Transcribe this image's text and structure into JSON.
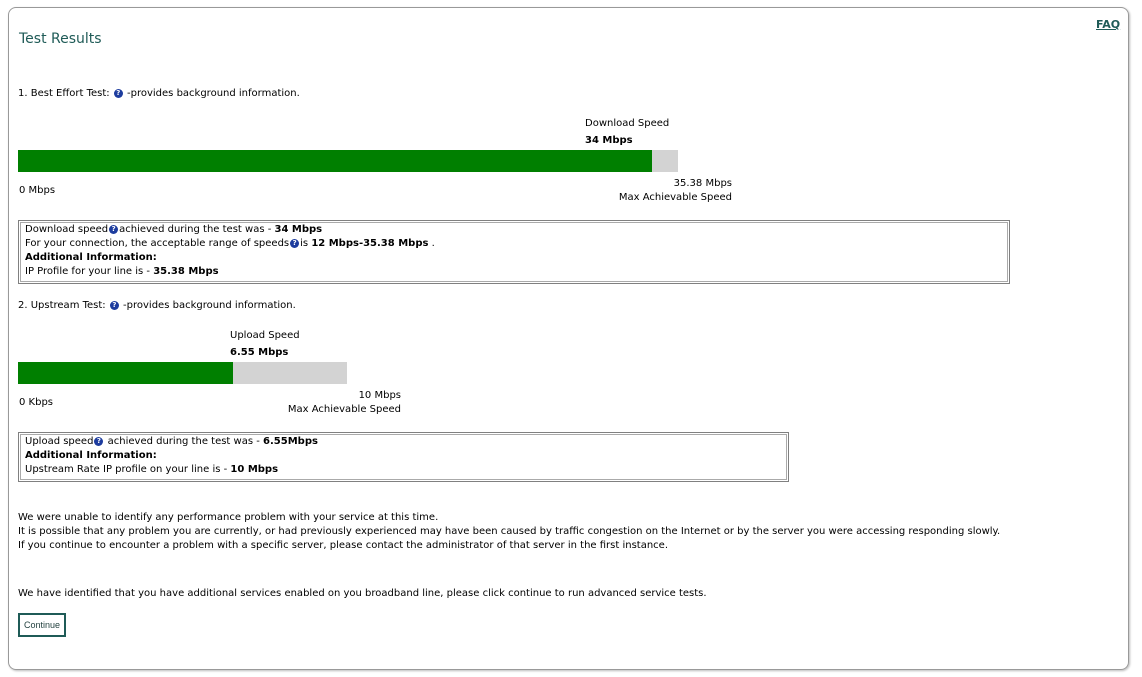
{
  "header": {
    "title": "Test Results",
    "faq_label": "FAQ"
  },
  "download": {
    "heading_prefix": "1. Best Effort Test:",
    "heading_suffix": "-provides background information.",
    "speed_label": "Download Speed",
    "speed_value": "34 Mbps",
    "min_label": "0 Mbps",
    "max_value": "35.38 Mbps",
    "max_label": "Max Achievable Speed",
    "fill_fraction": 0.961,
    "info": {
      "line1_prefix": "Download speed",
      "line1_mid": "achieved during the test was -",
      "line1_value": "34 Mbps",
      "line2_prefix": "For your connection, the acceptable range of speeds",
      "line2_mid": "is",
      "line2_value": "12 Mbps-35.38 Mbps",
      "line2_suffix": ".",
      "additional_label": "Additional Information:",
      "line4_prefix": "IP Profile for your line is -",
      "line4_value": "35.38 Mbps"
    }
  },
  "upload": {
    "heading_prefix": "2. Upstream Test:",
    "heading_suffix": "-provides background information.",
    "speed_label": "Upload Speed",
    "speed_value": "6.55 Mbps",
    "min_label": "0 Kbps",
    "max_value": "10 Mbps",
    "max_label": "Max Achievable Speed",
    "fill_fraction": 0.655,
    "info": {
      "line1_prefix": "Upload speed",
      "line1_mid": "achieved during the test was -",
      "line1_value": "6.55Mbps",
      "additional_label": "Additional Information:",
      "line3_prefix": "Upstream Rate IP profile on your line is -",
      "line3_value": "10 Mbps"
    }
  },
  "messages": {
    "line1": "We were unable to identify any performance problem with your service at this time.",
    "line2": "It is possible that any problem you are currently, or had previously experienced may have been caused by traffic congestion on the Internet or by the server you were accessing responding slowly.",
    "line3": "If you continue to encounter a problem with a specific server, please contact the administrator of that server in the first instance.",
    "additional": "We have identified that you have additional services enabled on you broadband line, please click continue to run advanced service tests."
  },
  "continue_label": "Continue",
  "colors": {
    "bar_fill": "#007f00",
    "bar_track": "#d3d3d3",
    "accent": "#1f5b57",
    "help_icon": "#1d3c9e"
  },
  "icons": {
    "help": "help-question-icon"
  }
}
